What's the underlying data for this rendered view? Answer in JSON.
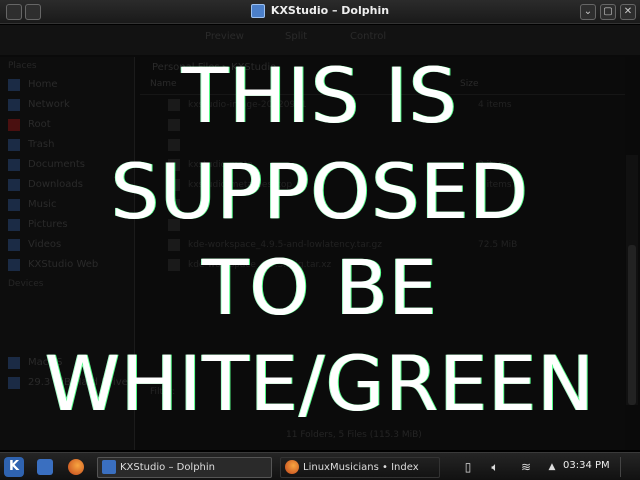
{
  "window": {
    "title": "KXStudio – Dolphin",
    "controls": [
      "⌄",
      "▢",
      "✕"
    ]
  },
  "overlay": {
    "lines": [
      "THIS IS",
      "SUPPOSED",
      "TO BE",
      "WHITE/GREEN"
    ]
  },
  "toolbar": {
    "items": [
      "Preview",
      "Split",
      "Control"
    ]
  },
  "places": {
    "heading": "Places",
    "items": [
      "Home",
      "Network",
      "Root",
      "Trash",
      "Documents",
      "Downloads",
      "Music",
      "Pictures",
      "Videos",
      "KXStudio Web"
    ],
    "devices_heading": "Devices",
    "devices": [
      "MacOS",
      "29.3 GiB Hard Drive"
    ]
  },
  "files": {
    "breadcrumb": "Personal Files ▸ KXStudio",
    "columns": [
      "Name",
      "Size"
    ],
    "rows": [
      {
        "name": "kxstudio-image-20120911",
        "size": "4 items"
      },
      {
        "name": "",
        "size": ""
      },
      {
        "name": "",
        "size": ""
      },
      {
        "name": "kxstudio-meta",
        "size": "3 items"
      },
      {
        "name": "kxstudio-meta-desktop",
        "size": "3 items"
      },
      {
        "name": "",
        "size": ""
      },
      {
        "name": "",
        "size": ""
      },
      {
        "name": "kde-workspace_4.9.5-and-lowlatency.tar.gz",
        "size": "72.5 MiB"
      },
      {
        "name": "kde-workspace_4.9.5.orig.tar.xz",
        "size": ""
      }
    ],
    "filter": "Filter:",
    "status": "11 Folders, 5 Files (115.3 MiB)"
  },
  "taskbar": {
    "start_icon": "K",
    "tasks": [
      {
        "label": "KXStudio – Dolphin",
        "active": true
      },
      {
        "label": "LinuxMusicians • Index page",
        "active": false
      }
    ],
    "clock": "03:34 PM"
  },
  "colors": {
    "overlay_text": "#ffffff",
    "overlay_glow": "#55ff88",
    "kde_blue": "#2f63b0"
  }
}
